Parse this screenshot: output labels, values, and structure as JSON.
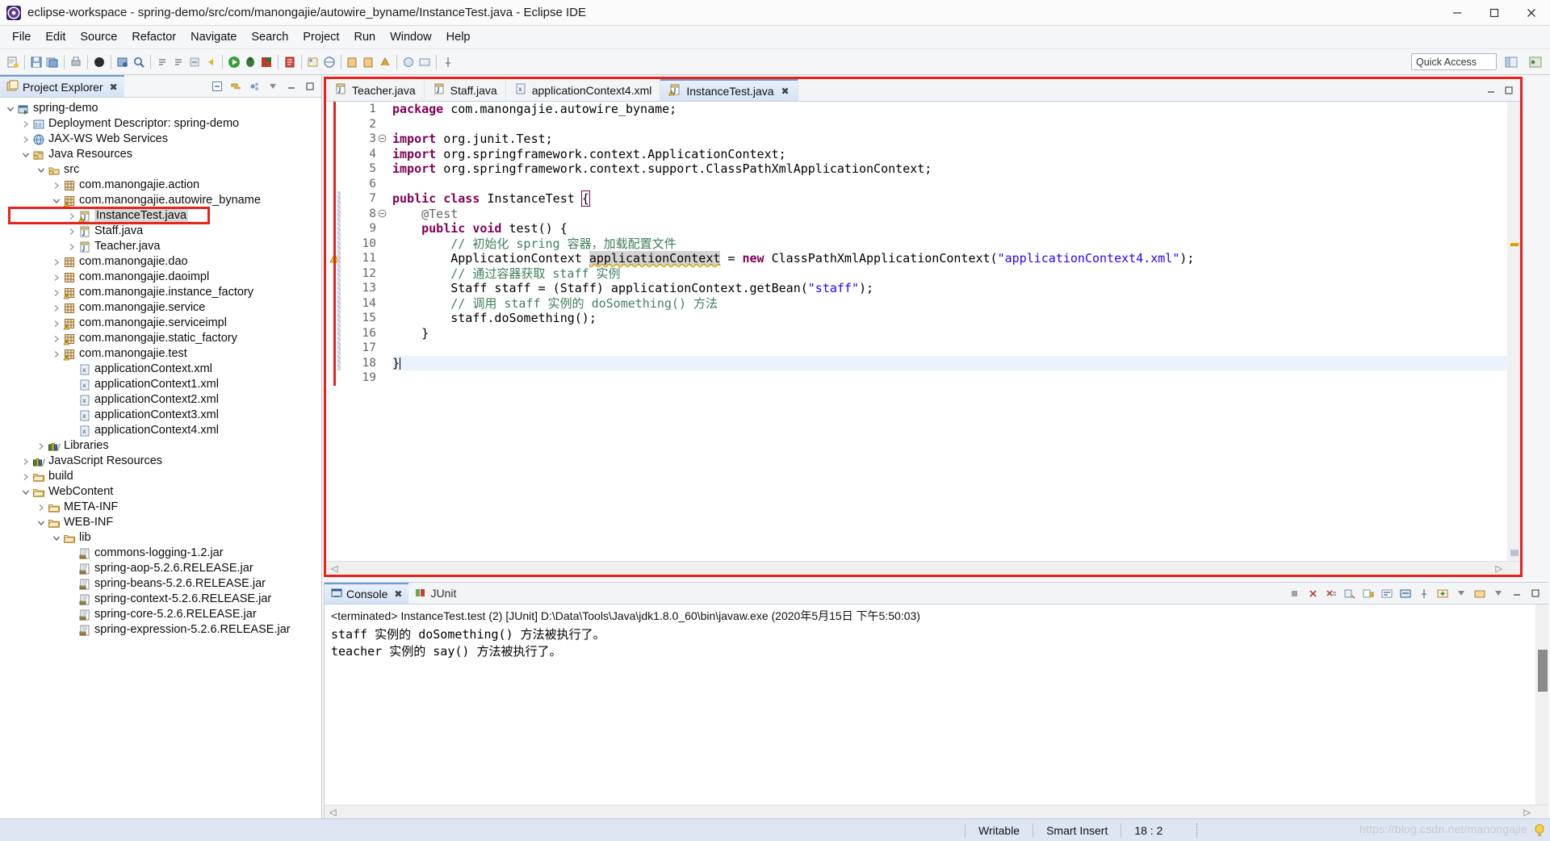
{
  "window": {
    "title": "eclipse-workspace - spring-demo/src/com/manongajie/autowire_byname/InstanceTest.java - Eclipse IDE",
    "app_icon": "eclipse-icon",
    "minimize": "—",
    "maximize": "❐",
    "close": "✕"
  },
  "menubar": {
    "items": [
      "File",
      "Edit",
      "Source",
      "Refactor",
      "Navigate",
      "Search",
      "Project",
      "Run",
      "Window",
      "Help"
    ]
  },
  "toolbar": {
    "quick_access_placeholder": "Quick Access"
  },
  "explorer": {
    "tab_label": "Project Explorer",
    "tab_close": "✖",
    "tools": [
      "collapse-all-icon",
      "link-with-editor-icon",
      "view-menu-icon",
      "minimize-icon",
      "maximize-icon"
    ],
    "tree": [
      {
        "label": "spring-demo",
        "depth": 0,
        "twisty": "down",
        "icon": "project-icon"
      },
      {
        "label": "Deployment Descriptor: spring-demo",
        "depth": 1,
        "twisty": "right",
        "icon": "deployment-descriptor-icon"
      },
      {
        "label": "JAX-WS Web Services",
        "depth": 1,
        "twisty": "right",
        "icon": "jaxws-icon"
      },
      {
        "label": "Java Resources",
        "depth": 1,
        "twisty": "down",
        "icon": "java-resources-icon"
      },
      {
        "label": "src",
        "depth": 2,
        "twisty": "down",
        "icon": "source-folder-icon"
      },
      {
        "label": "com.manongajie.action",
        "depth": 3,
        "twisty": "right",
        "icon": "package-icon"
      },
      {
        "label": "com.manongajie.autowire_byname",
        "depth": 3,
        "twisty": "down",
        "icon": "package-warning-icon"
      },
      {
        "label": "InstanceTest.java",
        "depth": 4,
        "twisty": "right",
        "icon": "java-warning-icon",
        "selected": true,
        "highlight": true
      },
      {
        "label": "Staff.java",
        "depth": 4,
        "twisty": "right",
        "icon": "java-icon"
      },
      {
        "label": "Teacher.java",
        "depth": 4,
        "twisty": "right",
        "icon": "java-icon"
      },
      {
        "label": "com.manongajie.dao",
        "depth": 3,
        "twisty": "right",
        "icon": "package-icon"
      },
      {
        "label": "com.manongajie.daoimpl",
        "depth": 3,
        "twisty": "right",
        "icon": "package-icon"
      },
      {
        "label": "com.manongajie.instance_factory",
        "depth": 3,
        "twisty": "right",
        "icon": "package-warning-icon"
      },
      {
        "label": "com.manongajie.service",
        "depth": 3,
        "twisty": "right",
        "icon": "package-icon"
      },
      {
        "label": "com.manongajie.serviceimpl",
        "depth": 3,
        "twisty": "right",
        "icon": "package-warning-icon"
      },
      {
        "label": "com.manongajie.static_factory",
        "depth": 3,
        "twisty": "right",
        "icon": "package-warning-icon"
      },
      {
        "label": "com.manongajie.test",
        "depth": 3,
        "twisty": "right",
        "icon": "package-warning-icon"
      },
      {
        "label": "applicationContext.xml",
        "depth": 4,
        "twisty": "none",
        "icon": "xml-icon"
      },
      {
        "label": "applicationContext1.xml",
        "depth": 4,
        "twisty": "none",
        "icon": "xml-icon"
      },
      {
        "label": "applicationContext2.xml",
        "depth": 4,
        "twisty": "none",
        "icon": "xml-icon"
      },
      {
        "label": "applicationContext3.xml",
        "depth": 4,
        "twisty": "none",
        "icon": "xml-icon"
      },
      {
        "label": "applicationContext4.xml",
        "depth": 4,
        "twisty": "none",
        "icon": "xml-icon"
      },
      {
        "label": "Libraries",
        "depth": 2,
        "twisty": "right",
        "icon": "library-icon"
      },
      {
        "label": "JavaScript Resources",
        "depth": 1,
        "twisty": "right",
        "icon": "library-icon"
      },
      {
        "label": "build",
        "depth": 1,
        "twisty": "right",
        "icon": "folder-icon"
      },
      {
        "label": "WebContent",
        "depth": 1,
        "twisty": "down",
        "icon": "folder-icon"
      },
      {
        "label": "META-INF",
        "depth": 2,
        "twisty": "right",
        "icon": "folder-icon"
      },
      {
        "label": "WEB-INF",
        "depth": 2,
        "twisty": "down",
        "icon": "folder-icon"
      },
      {
        "label": "lib",
        "depth": 3,
        "twisty": "down",
        "icon": "folder-icon"
      },
      {
        "label": "commons-logging-1.2.jar",
        "depth": 4,
        "twisty": "none",
        "icon": "jar-icon"
      },
      {
        "label": "spring-aop-5.2.6.RELEASE.jar",
        "depth": 4,
        "twisty": "none",
        "icon": "jar-icon"
      },
      {
        "label": "spring-beans-5.2.6.RELEASE.jar",
        "depth": 4,
        "twisty": "none",
        "icon": "jar-icon"
      },
      {
        "label": "spring-context-5.2.6.RELEASE.jar",
        "depth": 4,
        "twisty": "none",
        "icon": "jar-icon"
      },
      {
        "label": "spring-core-5.2.6.RELEASE.jar",
        "depth": 4,
        "twisty": "none",
        "icon": "jar-icon"
      },
      {
        "label": "spring-expression-5.2.6.RELEASE.jar",
        "depth": 4,
        "twisty": "none",
        "icon": "jar-icon"
      }
    ]
  },
  "editor": {
    "tabs": [
      {
        "label": "Teacher.java",
        "icon": "java-icon",
        "active": false
      },
      {
        "label": "Staff.java",
        "icon": "java-icon",
        "active": false
      },
      {
        "label": "applicationContext4.xml",
        "icon": "xml-icon",
        "active": false
      },
      {
        "label": "InstanceTest.java",
        "icon": "java-warning-icon",
        "active": true,
        "close": "✖"
      }
    ],
    "highlight_color": "#e8231a",
    "line_numbers": [
      "1",
      "2",
      "3",
      "4",
      "5",
      "6",
      "7",
      "8",
      "9",
      "10",
      "11",
      "12",
      "13",
      "14",
      "15",
      "16",
      "17",
      "18",
      "19"
    ],
    "fold_markers": {
      "3": "collapse",
      "8": "collapse"
    },
    "warning_line": 11,
    "cursor_line": 18,
    "lines": [
      {
        "n": 1,
        "tokens": [
          {
            "t": "package ",
            "c": "kw"
          },
          {
            "t": "com.manongajie.autowire_byname;",
            "c": "plain"
          }
        ]
      },
      {
        "n": 2,
        "tokens": []
      },
      {
        "n": 3,
        "tokens": [
          {
            "t": "import ",
            "c": "kw"
          },
          {
            "t": "org.junit.Test;",
            "c": "plain"
          }
        ]
      },
      {
        "n": 4,
        "tokens": [
          {
            "t": "import ",
            "c": "kw"
          },
          {
            "t": "org.springframework.context.ApplicationContext;",
            "c": "plain"
          }
        ]
      },
      {
        "n": 5,
        "tokens": [
          {
            "t": "import ",
            "c": "kw"
          },
          {
            "t": "org.springframework.context.support.ClassPathXmlApplicationContext;",
            "c": "plain"
          }
        ]
      },
      {
        "n": 6,
        "tokens": []
      },
      {
        "n": 7,
        "tokens": [
          {
            "t": "public class ",
            "c": "kw"
          },
          {
            "t": "InstanceTest ",
            "c": "plain"
          },
          {
            "t": "{",
            "c": "brace"
          }
        ]
      },
      {
        "n": 8,
        "tokens": [
          {
            "t": "    @Test",
            "c": "ann"
          }
        ]
      },
      {
        "n": 9,
        "tokens": [
          {
            "t": "    ",
            "c": "plain"
          },
          {
            "t": "public void ",
            "c": "kw"
          },
          {
            "t": "test() {",
            "c": "plain"
          }
        ]
      },
      {
        "n": 10,
        "tokens": [
          {
            "t": "        // 初始化 spring 容器，加载配置文件",
            "c": "cmt"
          }
        ]
      },
      {
        "n": 11,
        "tokens": [
          {
            "t": "        ApplicationContext ",
            "c": "plain"
          },
          {
            "t": "applicationContext",
            "c": "warn"
          },
          {
            "t": " = ",
            "c": "plain"
          },
          {
            "t": "new ",
            "c": "kw"
          },
          {
            "t": "ClassPathXmlApplicationContext(",
            "c": "plain"
          },
          {
            "t": "\"applicationContext4.xml\"",
            "c": "str"
          },
          {
            "t": ");",
            "c": "plain"
          }
        ]
      },
      {
        "n": 12,
        "tokens": [
          {
            "t": "        // 通过容器获取 staff 实例",
            "c": "cmt"
          }
        ]
      },
      {
        "n": 13,
        "tokens": [
          {
            "t": "        Staff staff = (Staff) applicationContext.getBean(",
            "c": "plain"
          },
          {
            "t": "\"staff\"",
            "c": "str"
          },
          {
            "t": ");",
            "c": "plain"
          }
        ]
      },
      {
        "n": 14,
        "tokens": [
          {
            "t": "        // 调用 staff 实例的 doSomething() 方法",
            "c": "cmt"
          }
        ]
      },
      {
        "n": 15,
        "tokens": [
          {
            "t": "        staff.doSomething();",
            "c": "plain"
          }
        ]
      },
      {
        "n": 16,
        "tokens": [
          {
            "t": "    }",
            "c": "plain"
          }
        ]
      },
      {
        "n": 17,
        "tokens": []
      },
      {
        "n": 18,
        "tokens": [
          {
            "t": "}",
            "c": "plain"
          }
        ]
      },
      {
        "n": 19,
        "tokens": []
      }
    ]
  },
  "console": {
    "tabs": [
      {
        "label": "Console",
        "icon": "console-icon",
        "active": true,
        "close": "✖"
      },
      {
        "label": "JUnit",
        "icon": "junit-icon",
        "active": false
      }
    ],
    "tools": [
      "terminate-icon",
      "remove-launch-icon",
      "remove-all-terminated-icon",
      "clear-console-icon",
      "scroll-lock-icon",
      "word-wrap-icon",
      "show-console-icon",
      "pin-console-icon",
      "display-selected-console-icon",
      "open-console-icon",
      "minimize-icon",
      "maximize-icon"
    ],
    "header": "<terminated> InstanceTest.test (2) [JUnit] D:\\Data\\Tools\\Java\\jdk1.8.0_60\\bin\\javaw.exe (2020年5月15日 下午5:50:03)",
    "output": [
      "staff 实例的 doSomething() 方法被执行了。",
      "teacher 实例的 say() 方法被执行了。"
    ]
  },
  "statusbar": {
    "writable": "Writable",
    "insert_mode": "Smart Insert",
    "position": "18 : 2",
    "watermark": "https://blog.csdn.net/manongajie"
  }
}
